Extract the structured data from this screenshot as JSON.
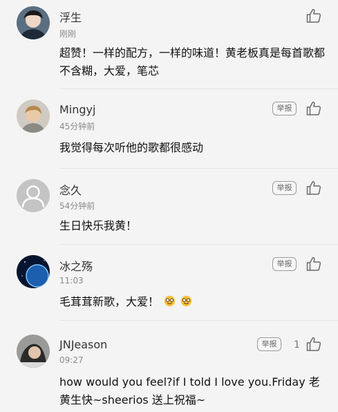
{
  "comments": [
    {
      "username": "浮生",
      "time": "刚刚",
      "text": "超赞！一样的配方，一样的味道！黄老板真是每首歌都不含糊，大爱，笔芯",
      "like_count": ""
    },
    {
      "username": "Mingyj",
      "time": "45分钟前",
      "text": "我觉得每次听他的歌都很感动",
      "report_label": "举报",
      "like_count": ""
    },
    {
      "username": "念久",
      "time": "54分钟前",
      "text": "生日快乐我黄！",
      "report_label": "举报",
      "like_count": ""
    },
    {
      "username": "冰之殇",
      "time": "11:03",
      "text": "毛茸茸新歌，大爱！",
      "emoji": [
        "nerd-emoji",
        "nerd-emoji"
      ],
      "report_label": "举报",
      "like_count": ""
    },
    {
      "username": "JNJeason",
      "time": "09:27",
      "text": "how would you feel?if I told I love you.Friday 老黄生快~sheerios 送上祝福~",
      "report_label": "举报",
      "like_count": "1"
    }
  ],
  "icons": {
    "like": "thumbs-up-icon",
    "default_avatar": "default-user-avatar-icon"
  },
  "colors": {
    "background": "#f4f4f4",
    "divider": "#e3e3e3",
    "time_text": "#8a8a8a",
    "icon_stroke": "#6a6a6a"
  }
}
